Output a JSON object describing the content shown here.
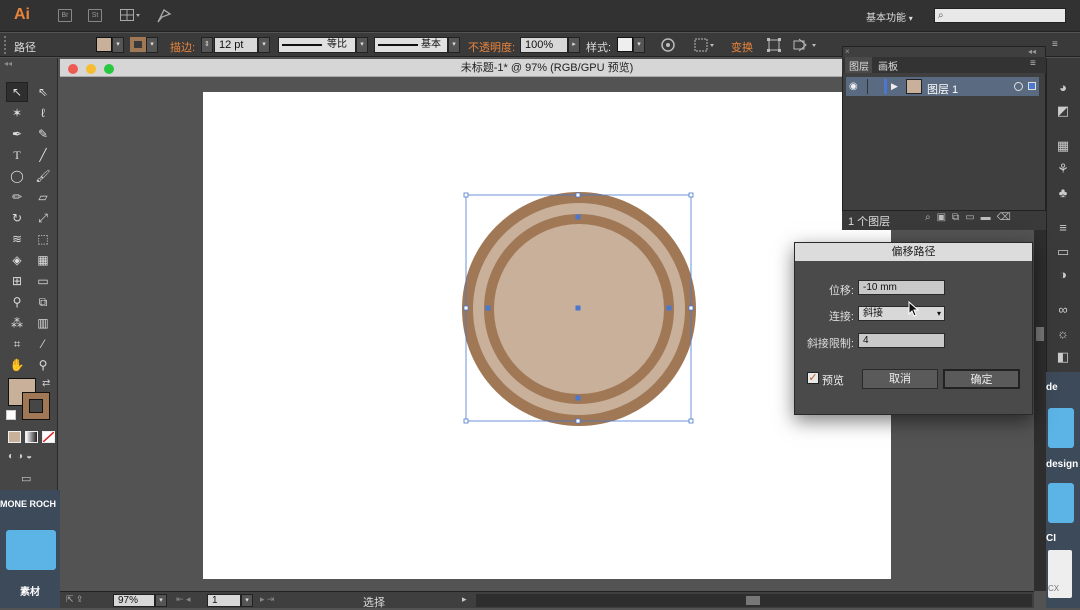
{
  "menubar": {
    "logo": "Ai",
    "bridge_label": "Br",
    "stock_label": "St",
    "workspace": "基本功能",
    "search_placeholder": ""
  },
  "control_bar": {
    "object_type": "路径",
    "stroke_label": "描边:",
    "stroke_weight": "12 pt",
    "profile_label": "等比",
    "brush_label": "基本",
    "opacity_label": "不透明度:",
    "opacity_value": "100%",
    "style_label": "样式:",
    "transform_label": "变换",
    "fill_color": "#c8b09a",
    "stroke_color": "#a07856"
  },
  "document": {
    "title": "未标题-1* @ 97% (RGB/GPU 预览)",
    "zoom": "97%",
    "artboard_number": "1",
    "status_tool": "选择"
  },
  "artwork": {
    "outer_ring_color": "#a07856",
    "fill_color": "#c8b09a",
    "selection_color": "#4a78d0"
  },
  "layers_panel": {
    "tabs": [
      "图层",
      "画板"
    ],
    "layer_name": "图层 1",
    "layer_count": "1 个图层"
  },
  "offset_dialog": {
    "title": "偏移路径",
    "offset_label": "位移:",
    "offset_value": "-10 mm",
    "joins_label": "连接:",
    "joins_value": "斜接",
    "miter_label": "斜接限制:",
    "miter_value": "4",
    "preview_label": "预览",
    "cancel_label": "取消",
    "ok_label": "确定"
  },
  "desktop": {
    "item1": "MONE ROCH",
    "folder_label": "素材",
    "right_text1": "de",
    "right_text2": "design",
    "right_text3": "CI",
    "right_text4": "CX"
  }
}
